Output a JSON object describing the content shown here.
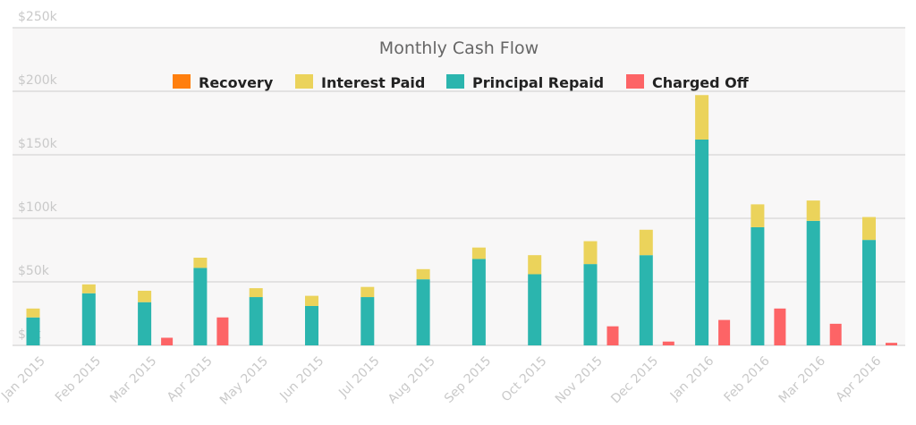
{
  "chart_data": {
    "type": "bar",
    "title": "Monthly Cash Flow",
    "categories": [
      "Jan 2015",
      "Feb 2015",
      "Mar 2015",
      "Apr 2015",
      "May 2015",
      "Jun 2015",
      "Jul 2015",
      "Aug 2015",
      "Sep 2015",
      "Oct 2015",
      "Nov 2015",
      "Dec 2015",
      "Jan 2016",
      "Feb 2016",
      "Mar 2016",
      "Apr 2016"
    ],
    "x_tick_labels": [
      "Jan 2015",
      "Feb 2015",
      "Mar 2015",
      "Apr 2015",
      "May 2015",
      "Jun 2015",
      "Jul 2015",
      "Aug 2015",
      "Sep 2015",
      "Oct 2015",
      "Nov 2015",
      "Dec 2015",
      "Jan 2016",
      "Feb 2016",
      "Mar 2016",
      "Apr 2016"
    ],
    "y_tick_labels": [
      "$0k",
      "$50k",
      "$100k",
      "$150k",
      "$200k",
      "$250k"
    ],
    "y_tick_values": [
      0,
      50,
      100,
      150,
      200,
      250
    ],
    "ylim": [
      0,
      250
    ],
    "y_unit": "thousands of dollars",
    "grid": true,
    "legend_position": "top",
    "stacked_series": [
      {
        "name": "Recovery",
        "color": "#ff7f0e",
        "values": [
          0,
          0,
          0,
          0,
          0,
          0,
          0,
          0,
          0,
          0,
          0,
          0,
          0,
          0,
          0,
          0
        ]
      },
      {
        "name": "Principal Repaid",
        "color": "#2bb5ae",
        "values": [
          22,
          41,
          34,
          61,
          38,
          31,
          38,
          52,
          68,
          56,
          64,
          71,
          162,
          93,
          98,
          83
        ]
      },
      {
        "name": "Interest Paid",
        "color": "#ebd35b",
        "values": [
          7,
          7,
          9,
          8,
          7,
          8,
          8,
          8,
          9,
          15,
          18,
          20,
          35,
          18,
          16,
          18
        ]
      }
    ],
    "separate_series": [
      {
        "name": "Charged Off",
        "color": "#fd6466",
        "values": [
          0,
          0,
          6,
          22,
          0,
          0,
          0,
          0,
          0,
          0,
          15,
          3,
          20,
          29,
          17,
          2
        ]
      }
    ],
    "legend": [
      {
        "name": "Recovery",
        "color": "#ff7f0e"
      },
      {
        "name": "Interest Paid",
        "color": "#ebd35b"
      },
      {
        "name": "Principal Repaid",
        "color": "#2bb5ae"
      },
      {
        "name": "Charged Off",
        "color": "#fd6466"
      }
    ],
    "colors": {
      "plot_background": "#f8f7f7",
      "grid": "#dcdcdc",
      "tick_text": "#c9c9c9",
      "title_text": "#666666"
    }
  }
}
